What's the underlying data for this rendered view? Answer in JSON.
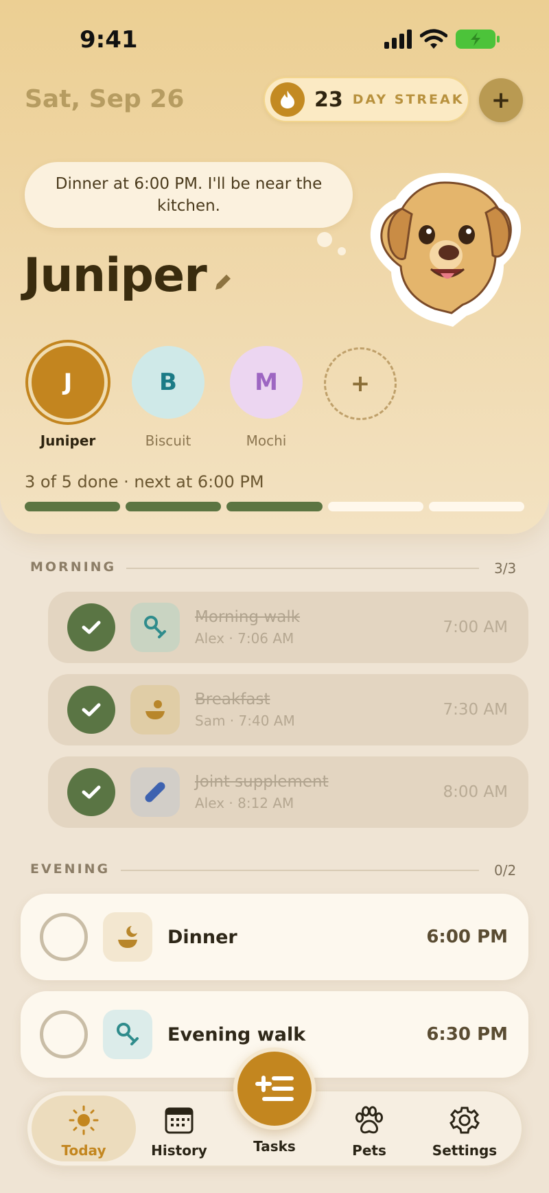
{
  "status": {
    "time": "9:41"
  },
  "header": {
    "date": "Sat, Sep 26",
    "streak_count": "23",
    "streak_label": "DAY STREAK",
    "add_symbol": "+"
  },
  "pet": {
    "message": "Dinner at 6:00 PM. I'll be near the kitchen.",
    "name": "Juniper"
  },
  "pets": [
    {
      "initial": "J",
      "name": "Juniper",
      "color": "#c3851f"
    },
    {
      "initial": "B",
      "name": "Biscuit",
      "color": "#cfe9e8"
    },
    {
      "initial": "M",
      "name": "Mochi",
      "color": "#ecd6f1"
    }
  ],
  "add_pet_symbol": "+",
  "progress": {
    "text": "3 of 5 done · next at 6:00 PM",
    "done": 3,
    "total": 5
  },
  "sections": {
    "morning": {
      "title": "MORNING",
      "count": "3/3",
      "tasks": [
        {
          "name": "Morning walk",
          "meta": "Alex · 7:06 AM",
          "time": "7:00 AM",
          "icon": "leash-icon"
        },
        {
          "name": "Breakfast",
          "meta": "Sam · 7:40 AM",
          "time": "7:30 AM",
          "icon": "food-bowl-icon"
        },
        {
          "name": "Joint supplement",
          "meta": "Alex · 8:12 AM",
          "time": "8:00 AM",
          "icon": "pill-icon"
        }
      ]
    },
    "evening": {
      "title": "EVENING",
      "count": "0/2",
      "tasks": [
        {
          "name": "Dinner",
          "time": "6:00 PM",
          "icon": "dinner-bowl-icon"
        },
        {
          "name": "Evening walk",
          "time": "6:30 PM",
          "icon": "leash-icon"
        }
      ]
    }
  },
  "nav": {
    "today": "Today",
    "history": "History",
    "tasks": "Tasks",
    "pets": "Pets",
    "settings": "Settings"
  },
  "colors": {
    "accent": "#c3861f",
    "done_green": "#5a7544"
  }
}
